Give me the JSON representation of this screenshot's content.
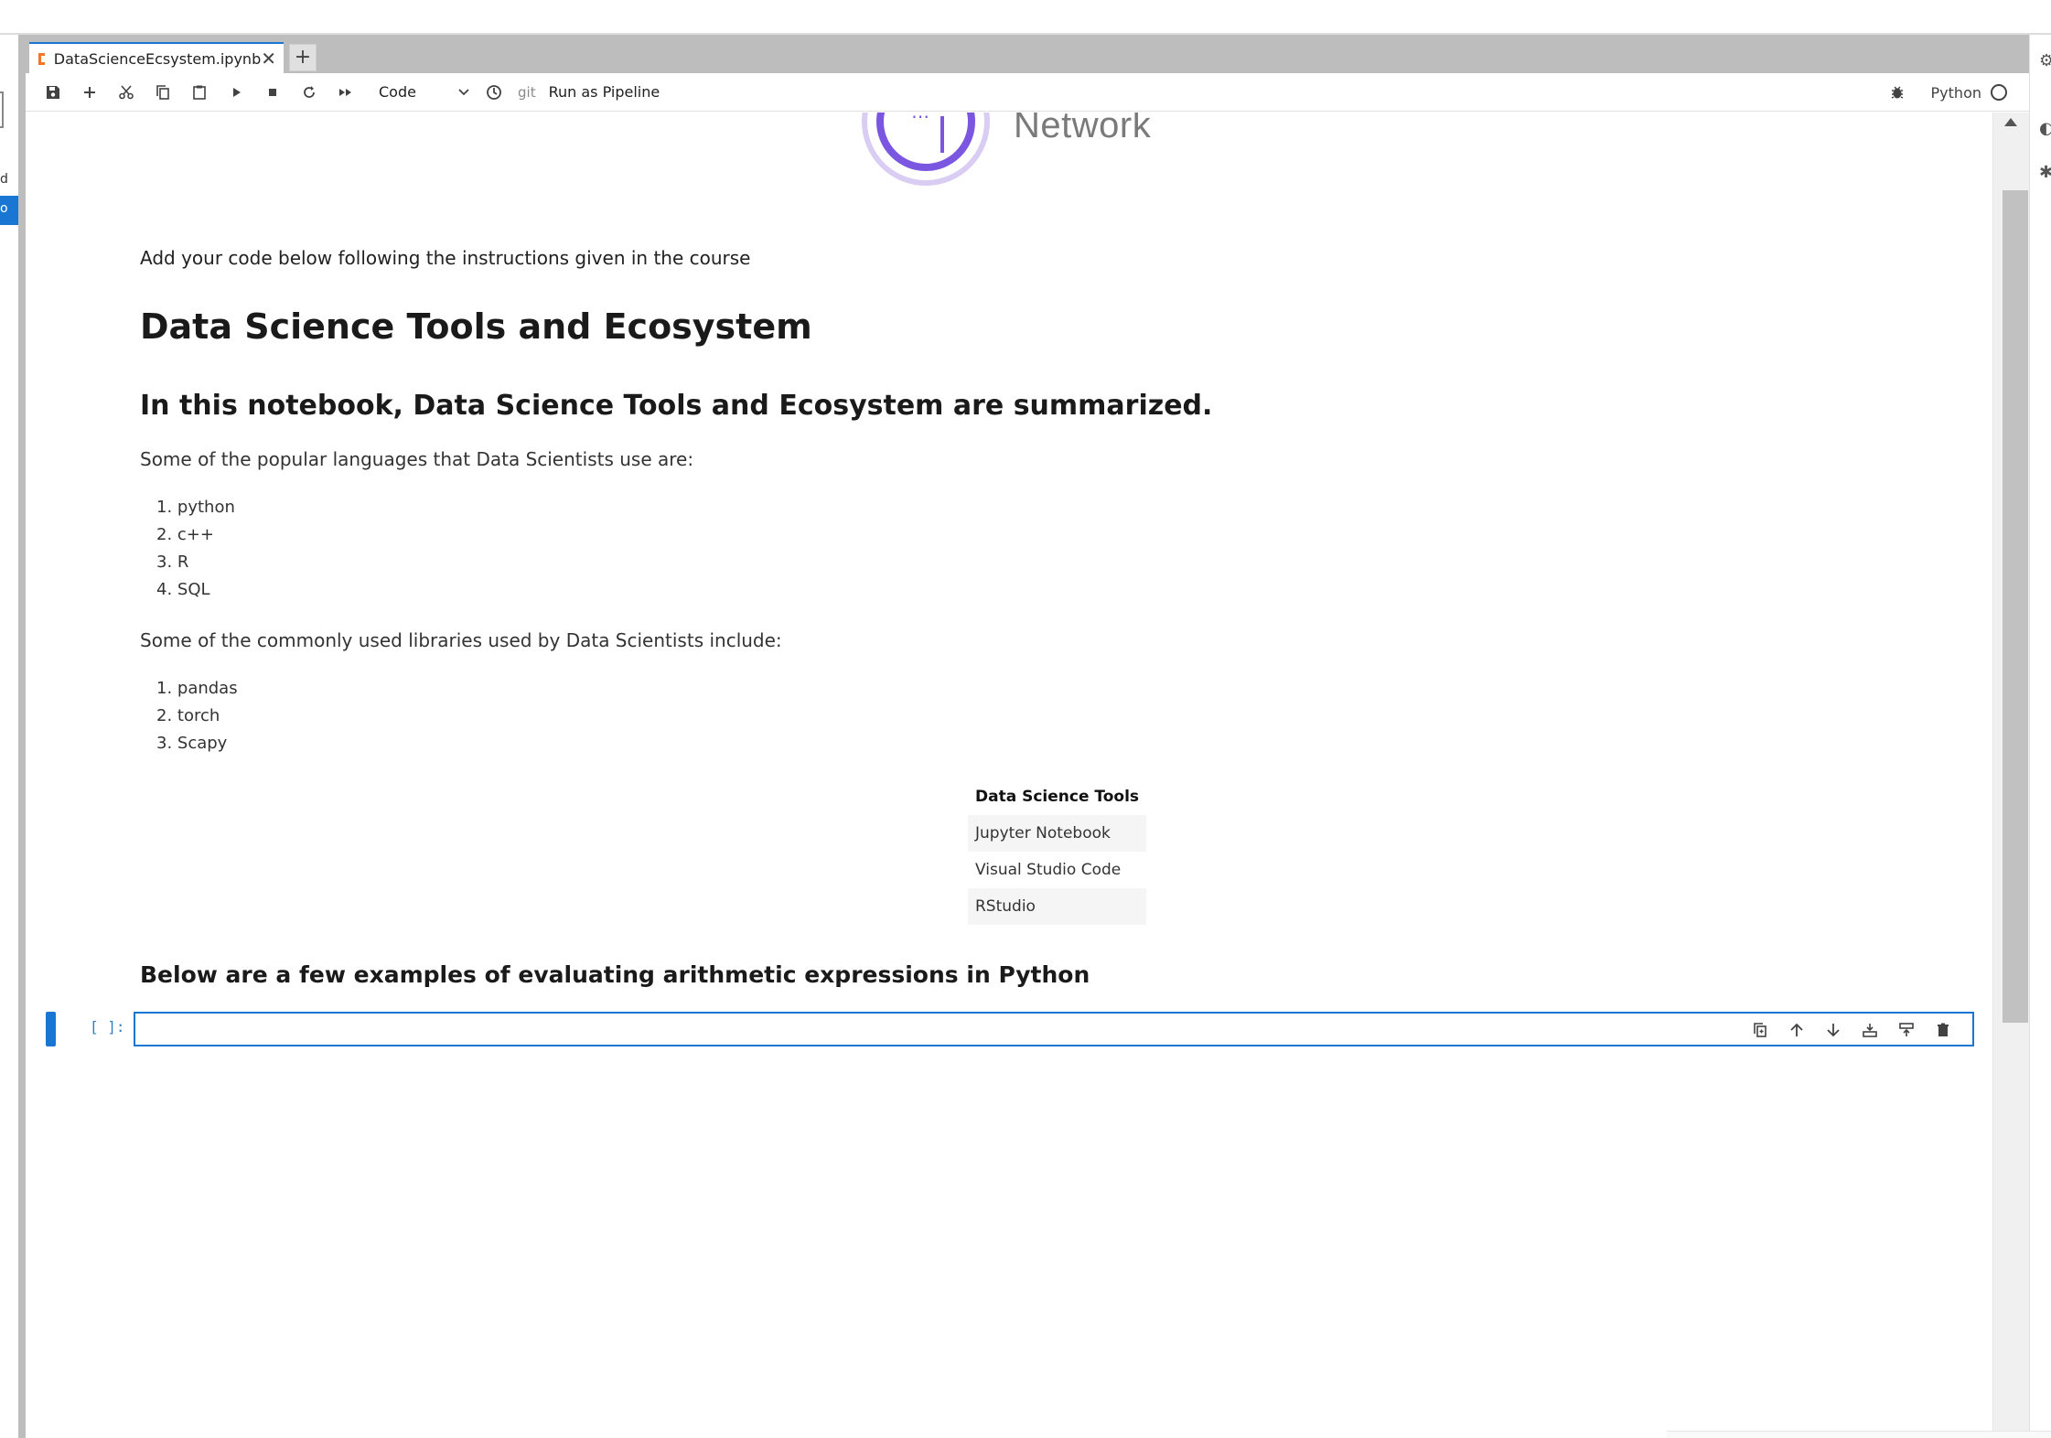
{
  "tab": {
    "filename": "DataScienceEcsystem.ipynb",
    "close": "✕",
    "add": "+"
  },
  "toolbar": {
    "cell_type": "Code",
    "git_label": "git",
    "pipeline_label": "Run as Pipeline",
    "kernel_name": "Python"
  },
  "sidebar": {
    "partial_text_1": "d",
    "partial_text_2": "o"
  },
  "notebook": {
    "logo_text": "Network",
    "instructions": "Add your code below following the instructions given in the course",
    "title": "Data Science Tools and Ecosystem",
    "subtitle": "In this notebook, Data Science Tools and Ecosystem are summarized.",
    "languages_intro": "Some of the popular languages that Data Scientists use are:",
    "languages": [
      "1. python",
      "2. c++",
      "3. R",
      "4. SQL"
    ],
    "libraries_intro": "Some of the commonly used libraries used by Data Scientists include:",
    "libraries": [
      "1. pandas",
      "2. torch",
      "3. Scapy"
    ],
    "tools_table": {
      "header": "Data Science Tools",
      "rows": [
        "Jupyter Notebook",
        "Visual Studio Code",
        "RStudio"
      ]
    },
    "examples_heading": "Below are a few examples of evaluating arithmetic expressions in Python",
    "cell_prompt": "[ ]:"
  },
  "colors": {
    "accent": "#1976d2",
    "logo_purple": "#7b56e0",
    "notebook_icon": "#f37726"
  }
}
